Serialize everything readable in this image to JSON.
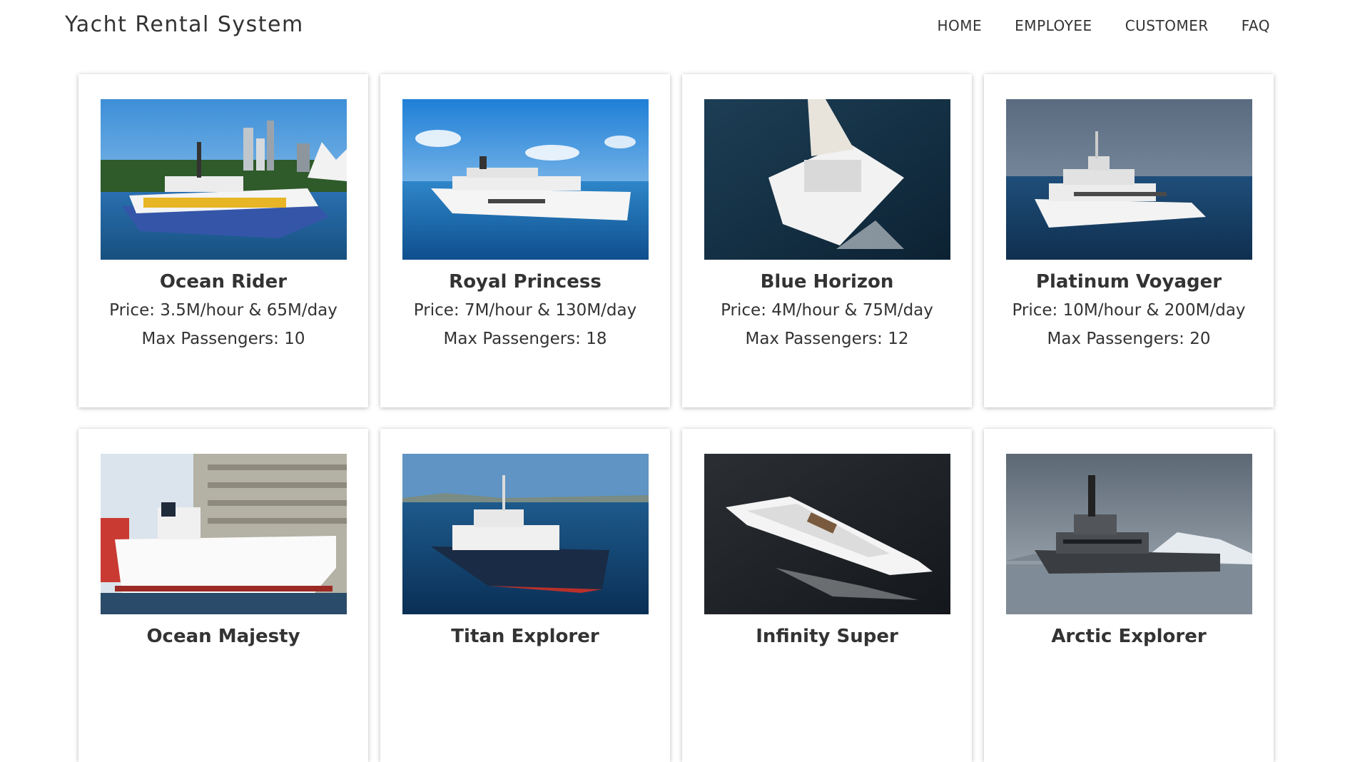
{
  "app": {
    "title": "Yacht Rental System"
  },
  "nav": [
    {
      "label": "HOME"
    },
    {
      "label": "EMPLOYEE"
    },
    {
      "label": "CUSTOMER"
    },
    {
      "label": "FAQ"
    }
  ],
  "yachts": [
    {
      "name": "Ocean Rider",
      "price": "Price: 3.5M/hour & 65M/day",
      "passengers": "Max Passengers: 10",
      "image": "ferry-photo"
    },
    {
      "name": "Royal Princess",
      "price": "Price: 7M/hour & 130M/day",
      "passengers": "Max Passengers: 18",
      "image": "superyacht-photo"
    },
    {
      "name": "Blue Horizon",
      "price": "Price: 4M/hour & 75M/day",
      "passengers": "Max Passengers: 12",
      "image": "catamaran-photo"
    },
    {
      "name": "Platinum Voyager",
      "price": "Price: 10M/hour & 200M/day",
      "passengers": "Max Passengers: 20",
      "image": "motor-yacht-photo"
    },
    {
      "name": "Ocean Majesty",
      "price": "",
      "passengers": "",
      "image": "cruise-ship-photo"
    },
    {
      "name": "Titan Explorer",
      "price": "",
      "passengers": "",
      "image": "expedition-yacht-photo"
    },
    {
      "name": "Infinity Super",
      "price": "",
      "passengers": "",
      "image": "superyacht-aerial-photo"
    },
    {
      "name": "Arctic Explorer",
      "price": "",
      "passengers": "",
      "image": "explorer-yacht-photo"
    }
  ]
}
